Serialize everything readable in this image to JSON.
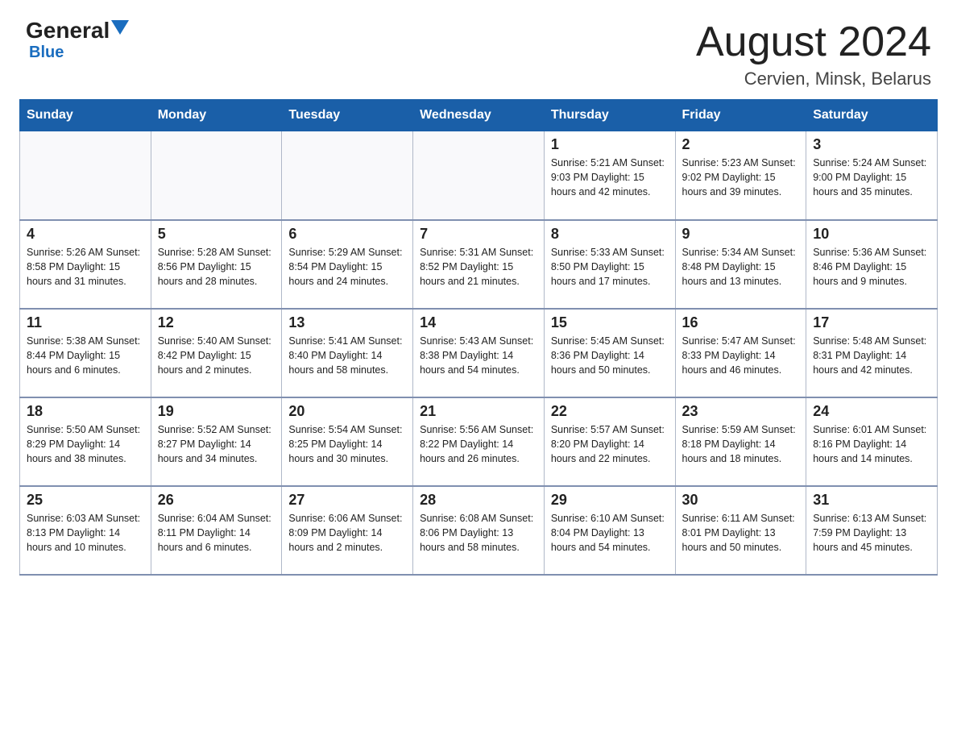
{
  "header": {
    "logo_general": "General",
    "logo_blue": "Blue",
    "month_year": "August 2024",
    "location": "Cervien, Minsk, Belarus"
  },
  "weekdays": [
    "Sunday",
    "Monday",
    "Tuesday",
    "Wednesday",
    "Thursday",
    "Friday",
    "Saturday"
  ],
  "weeks": [
    [
      {
        "day": "",
        "info": ""
      },
      {
        "day": "",
        "info": ""
      },
      {
        "day": "",
        "info": ""
      },
      {
        "day": "",
        "info": ""
      },
      {
        "day": "1",
        "info": "Sunrise: 5:21 AM\nSunset: 9:03 PM\nDaylight: 15 hours and 42 minutes."
      },
      {
        "day": "2",
        "info": "Sunrise: 5:23 AM\nSunset: 9:02 PM\nDaylight: 15 hours and 39 minutes."
      },
      {
        "day": "3",
        "info": "Sunrise: 5:24 AM\nSunset: 9:00 PM\nDaylight: 15 hours and 35 minutes."
      }
    ],
    [
      {
        "day": "4",
        "info": "Sunrise: 5:26 AM\nSunset: 8:58 PM\nDaylight: 15 hours and 31 minutes."
      },
      {
        "day": "5",
        "info": "Sunrise: 5:28 AM\nSunset: 8:56 PM\nDaylight: 15 hours and 28 minutes."
      },
      {
        "day": "6",
        "info": "Sunrise: 5:29 AM\nSunset: 8:54 PM\nDaylight: 15 hours and 24 minutes."
      },
      {
        "day": "7",
        "info": "Sunrise: 5:31 AM\nSunset: 8:52 PM\nDaylight: 15 hours and 21 minutes."
      },
      {
        "day": "8",
        "info": "Sunrise: 5:33 AM\nSunset: 8:50 PM\nDaylight: 15 hours and 17 minutes."
      },
      {
        "day": "9",
        "info": "Sunrise: 5:34 AM\nSunset: 8:48 PM\nDaylight: 15 hours and 13 minutes."
      },
      {
        "day": "10",
        "info": "Sunrise: 5:36 AM\nSunset: 8:46 PM\nDaylight: 15 hours and 9 minutes."
      }
    ],
    [
      {
        "day": "11",
        "info": "Sunrise: 5:38 AM\nSunset: 8:44 PM\nDaylight: 15 hours and 6 minutes."
      },
      {
        "day": "12",
        "info": "Sunrise: 5:40 AM\nSunset: 8:42 PM\nDaylight: 15 hours and 2 minutes."
      },
      {
        "day": "13",
        "info": "Sunrise: 5:41 AM\nSunset: 8:40 PM\nDaylight: 14 hours and 58 minutes."
      },
      {
        "day": "14",
        "info": "Sunrise: 5:43 AM\nSunset: 8:38 PM\nDaylight: 14 hours and 54 minutes."
      },
      {
        "day": "15",
        "info": "Sunrise: 5:45 AM\nSunset: 8:36 PM\nDaylight: 14 hours and 50 minutes."
      },
      {
        "day": "16",
        "info": "Sunrise: 5:47 AM\nSunset: 8:33 PM\nDaylight: 14 hours and 46 minutes."
      },
      {
        "day": "17",
        "info": "Sunrise: 5:48 AM\nSunset: 8:31 PM\nDaylight: 14 hours and 42 minutes."
      }
    ],
    [
      {
        "day": "18",
        "info": "Sunrise: 5:50 AM\nSunset: 8:29 PM\nDaylight: 14 hours and 38 minutes."
      },
      {
        "day": "19",
        "info": "Sunrise: 5:52 AM\nSunset: 8:27 PM\nDaylight: 14 hours and 34 minutes."
      },
      {
        "day": "20",
        "info": "Sunrise: 5:54 AM\nSunset: 8:25 PM\nDaylight: 14 hours and 30 minutes."
      },
      {
        "day": "21",
        "info": "Sunrise: 5:56 AM\nSunset: 8:22 PM\nDaylight: 14 hours and 26 minutes."
      },
      {
        "day": "22",
        "info": "Sunrise: 5:57 AM\nSunset: 8:20 PM\nDaylight: 14 hours and 22 minutes."
      },
      {
        "day": "23",
        "info": "Sunrise: 5:59 AM\nSunset: 8:18 PM\nDaylight: 14 hours and 18 minutes."
      },
      {
        "day": "24",
        "info": "Sunrise: 6:01 AM\nSunset: 8:16 PM\nDaylight: 14 hours and 14 minutes."
      }
    ],
    [
      {
        "day": "25",
        "info": "Sunrise: 6:03 AM\nSunset: 8:13 PM\nDaylight: 14 hours and 10 minutes."
      },
      {
        "day": "26",
        "info": "Sunrise: 6:04 AM\nSunset: 8:11 PM\nDaylight: 14 hours and 6 minutes."
      },
      {
        "day": "27",
        "info": "Sunrise: 6:06 AM\nSunset: 8:09 PM\nDaylight: 14 hours and 2 minutes."
      },
      {
        "day": "28",
        "info": "Sunrise: 6:08 AM\nSunset: 8:06 PM\nDaylight: 13 hours and 58 minutes."
      },
      {
        "day": "29",
        "info": "Sunrise: 6:10 AM\nSunset: 8:04 PM\nDaylight: 13 hours and 54 minutes."
      },
      {
        "day": "30",
        "info": "Sunrise: 6:11 AM\nSunset: 8:01 PM\nDaylight: 13 hours and 50 minutes."
      },
      {
        "day": "31",
        "info": "Sunrise: 6:13 AM\nSunset: 7:59 PM\nDaylight: 13 hours and 45 minutes."
      }
    ]
  ]
}
